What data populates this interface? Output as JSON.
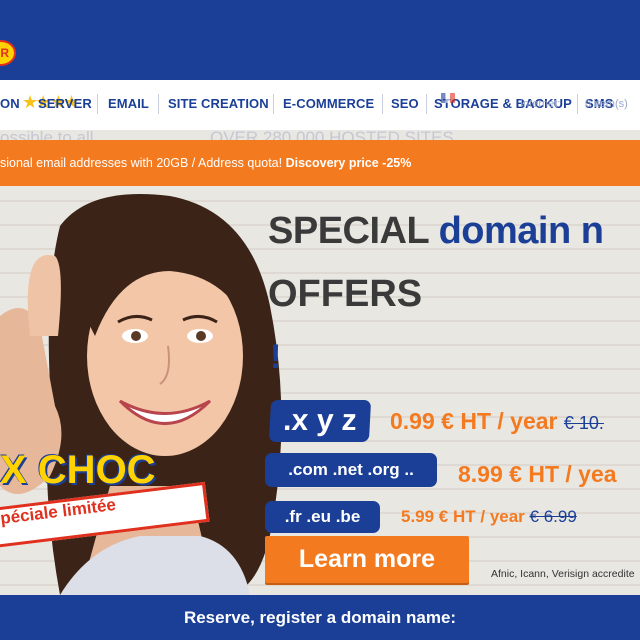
{
  "logo": {
    "visible_text": "R"
  },
  "nav": {
    "items": [
      {
        "label": "ON",
        "name": "nav-item-domain"
      },
      {
        "label": "SERVER",
        "name": "nav-item-server"
      },
      {
        "label": "EMAIL",
        "name": "nav-item-email"
      },
      {
        "label": "SITE CREATION",
        "name": "nav-item-site-creation"
      },
      {
        "label": "E-COMMERCE",
        "name": "nav-item-ecommerce"
      },
      {
        "label": "SEO",
        "name": "nav-item-seo"
      },
      {
        "label": "STORAGE & BACKUP",
        "name": "nav-item-storage-backup"
      },
      {
        "label": "SMS",
        "name": "nav-item-sms"
      }
    ],
    "ghost_left": "Internet:",
    "ghost_right": "0 item(s)"
  },
  "hero": {
    "ghost_left": "ossible to all",
    "ghost_center": "OVER 280 000 HOSTED SITES",
    "promo_text": "sional email addresses with 20GB / Address quota!",
    "promo_bold": "Discovery price -25%",
    "headline_prefix": "SPECIAL",
    "headline_blue": "domain n",
    "headline_line2": "OFFERS",
    "headline_excl": "!",
    "offers": [
      {
        "tag": ".x y z",
        "price": "0.99 € HT / year",
        "old_price": "€ 10."
      },
      {
        "tag": ".com .net .org ..",
        "price": "8.99 € HT / yea",
        "old_price": ""
      },
      {
        "tag": ".fr .eu .be",
        "price": "5.99 € HT / year",
        "old_price": "€ 6.99"
      }
    ],
    "cta_label": "Learn more",
    "accreditation": "Afnic, Icann, Verisign accredite",
    "choc_text": "X CHOC",
    "ribbon_text": "péciale limitée"
  },
  "footer": {
    "title": "Reserve, register a domain name:"
  },
  "colors": {
    "brand_blue": "#1b3f97",
    "accent_orange": "#f47a20",
    "accent_yellow": "#ffd200",
    "accent_red": "#e0301e"
  }
}
